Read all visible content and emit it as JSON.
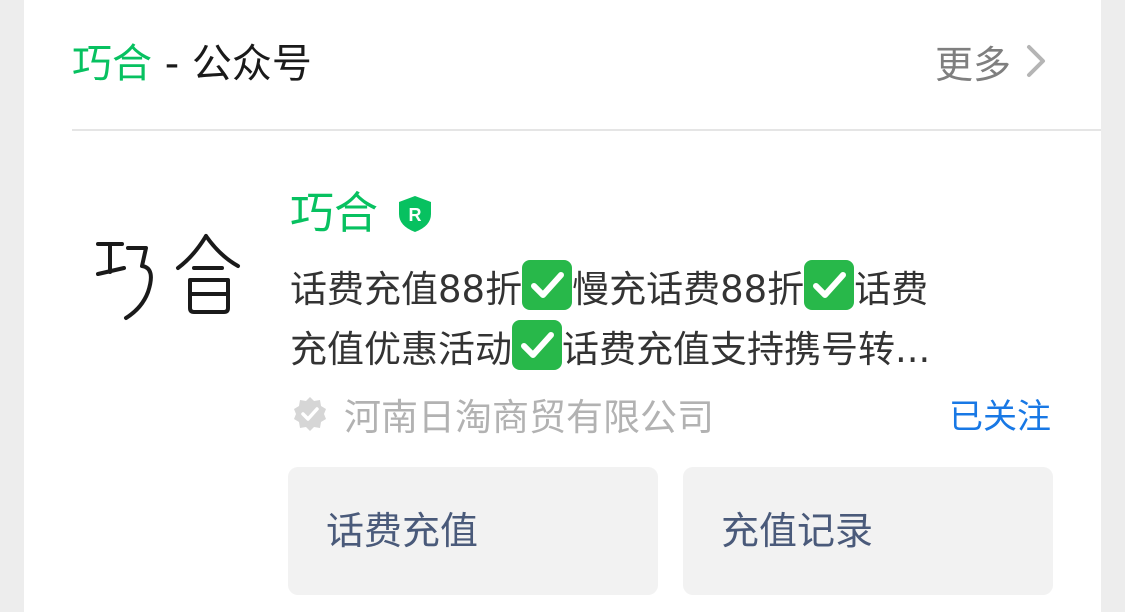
{
  "header": {
    "title_accent": "巧合",
    "title_rest": " - 公众号",
    "more_label": "更多",
    "more_icon": "chevron-right-icon"
  },
  "account": {
    "logo_icon": "qiaohe-logo",
    "name": "巧合",
    "verified_icon": "shield-r-badge-icon",
    "description_lines": [
      [
        "话费充值88折",
        "✅",
        "慢充话费88折",
        "✅",
        "话费"
      ],
      [
        "充值优惠活动",
        "✅",
        "话费充值支持携号转..."
      ]
    ],
    "company_icon": "verified-gear-icon",
    "company": "河南日淘商贸有限公司",
    "follow_status": "已关注"
  },
  "menu": [
    {
      "label": "话费充值"
    },
    {
      "label": "充值记录"
    }
  ],
  "colors": {
    "accent": "#07c160",
    "link": "#1878e5",
    "check": "#28b84a"
  }
}
